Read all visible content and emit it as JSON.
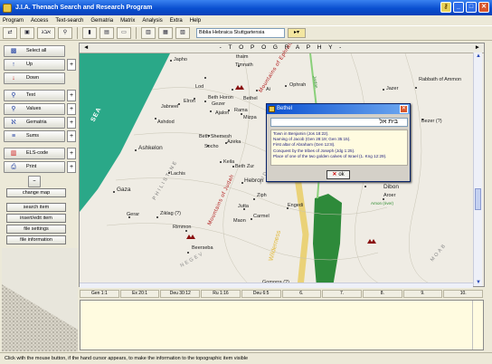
{
  "window": {
    "title": "J.I.A. Thenach Search and Research Program"
  },
  "menu": [
    "Program",
    "Access",
    "Text-search",
    "Gematria",
    "Matrix",
    "Analysis",
    "Extra",
    "Help"
  ],
  "toolbar": {
    "bible_select": "Biblia Hebraica Stuttgartensia"
  },
  "left_panel": {
    "select_all": "Select all",
    "up": "Up",
    "down": "Down",
    "text": "Text",
    "values": "Values",
    "gematria": "Gematria",
    "sums": "Sums",
    "els_code": "ELS-code",
    "print": "Print",
    "change_map": "change map",
    "search_item": "search item",
    "insert_edit_item": "insert/edit item",
    "file_settings": "file settings",
    "file_information": "file information"
  },
  "map": {
    "header": "- T O P O G R A P H Y -",
    "places": [
      {
        "name": "Japho"
      },
      {
        "name": "thaim"
      },
      {
        "name": "Timnath"
      },
      {
        "name": "Ophrah"
      },
      {
        "name": "Lod"
      },
      {
        "name": "Beth Horon"
      },
      {
        "name": "Bethel"
      },
      {
        "name": "Ai"
      },
      {
        "name": "Jabneel"
      },
      {
        "name": "Elron"
      },
      {
        "name": "Gezer"
      },
      {
        "name": "Ajalon"
      },
      {
        "name": "Rama"
      },
      {
        "name": "Mizpa"
      },
      {
        "name": "Ashdod"
      },
      {
        "name": "Beth Shemesh"
      },
      {
        "name": "Socho"
      },
      {
        "name": "Azeka"
      },
      {
        "name": "Ashkelon"
      },
      {
        "name": "Keila"
      },
      {
        "name": "Lachis"
      },
      {
        "name": "Beth Zur"
      },
      {
        "name": "Gaza"
      },
      {
        "name": "Hebron"
      },
      {
        "name": "Ziph"
      },
      {
        "name": "Gerar"
      },
      {
        "name": "Ziklag (?)"
      },
      {
        "name": "Jutta"
      },
      {
        "name": "Carmel"
      },
      {
        "name": "Maon"
      },
      {
        "name": "Rimmon"
      },
      {
        "name": "Engedi"
      },
      {
        "name": "Beerseba"
      },
      {
        "name": "Jazer"
      },
      {
        "name": "Rabbath of Ammon"
      },
      {
        "name": "Bezer (?)"
      },
      {
        "name": "Dibon"
      },
      {
        "name": "Aroer"
      },
      {
        "name": "Gomorra (?)"
      },
      {
        "name": "Machaerus"
      },
      {
        "name": "Medeba"
      },
      {
        "name": "Heshbon"
      }
    ],
    "regions": [
      "SEA",
      "Mountains of Ephraim",
      "Mountains of Judah",
      "PHILISTINE",
      "Wilderness",
      "JUDAH",
      "MOAB",
      "NEGEV",
      "Jordan",
      "Arnon (river)"
    ]
  },
  "references": [
    "Gen 1:1",
    "Ex 20:1",
    "Deu 30:12",
    "Ru 1:16",
    "Deu 6:5",
    "6.",
    "7.",
    "8.",
    "9.",
    "10."
  ],
  "dialog": {
    "title": "Bethel",
    "hebrew": "בית אל",
    "info": [
      "Town in Benjamin (Jos 18:22).",
      "Naming of Jacob (Gen 28:19; Gen 35:15).",
      "First altar of Abraham (Gen 12:8).",
      "Conquest by the tribes of Joseph (Jdg 1:25).",
      "Place of one of the two golden calves of Israel (1. Kng 12:29)."
    ],
    "ok": "ok"
  },
  "status": "Click with the mouse button, if the hand cursor appears, to make the information to the topographic item visible",
  "colors": {
    "sea": "#2aa888",
    "mountain_red": "#b01a1a",
    "dead_sea": "#2e8a3a",
    "titlebar": "#0a4fd0"
  }
}
